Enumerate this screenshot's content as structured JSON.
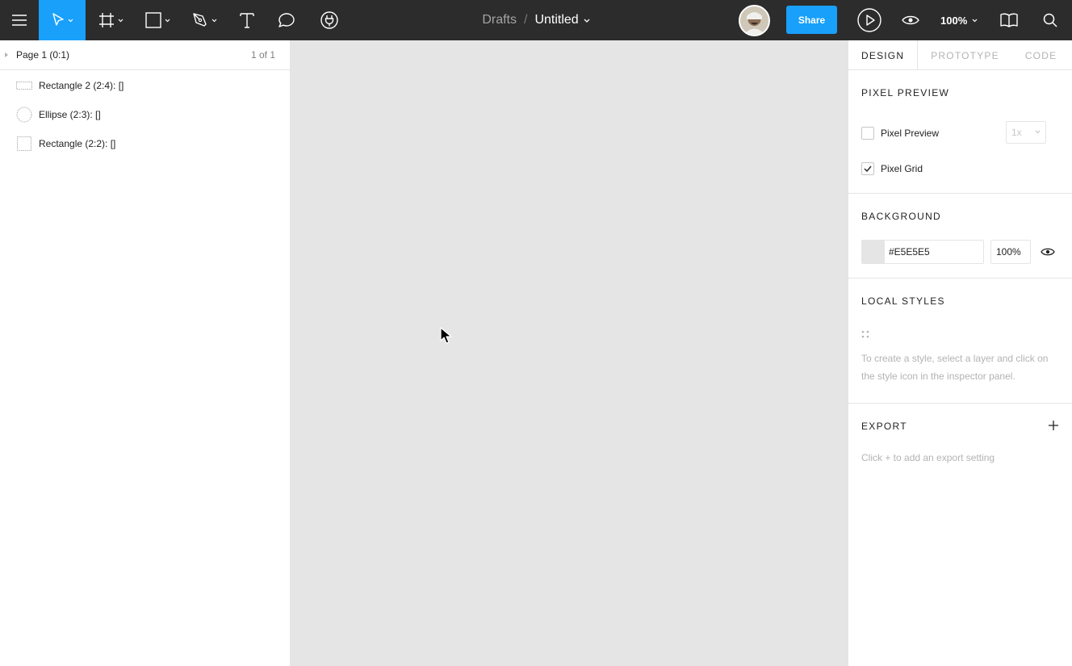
{
  "toolbar": {
    "zoom": "100%",
    "share_label": "Share",
    "icons": [
      "hamburger-menu-icon",
      "move-tool-icon",
      "frame-tool-icon",
      "rectangle-tool-icon",
      "pen-tool-icon",
      "text-tool-icon",
      "comment-tool-icon",
      "plugins-icon",
      "play-icon",
      "eye-icon",
      "library-icon",
      "search-icon"
    ],
    "accent": "#18A0FB"
  },
  "breadcrumb": {
    "project": "Drafts",
    "separator": "/",
    "file": "Untitled"
  },
  "layers": {
    "page": "Page 1 (0:1)",
    "page_count": "1 of 1",
    "items": [
      {
        "label": "Rectangle 2 (2:4): []",
        "icon": "rectangle-wide-icon"
      },
      {
        "label": "Ellipse (2:3): []",
        "icon": "ellipse-icon"
      },
      {
        "label": "Rectangle (2:2): []",
        "icon": "rectangle-icon"
      }
    ]
  },
  "props": {
    "tabs": [
      "DESIGN",
      "PROTOTYPE",
      "CODE"
    ],
    "pixel_preview": {
      "title": "PIXEL PREVIEW",
      "preview_label": "Pixel Preview",
      "preview_checked": false,
      "scale": "1x",
      "grid_label": "Pixel Grid",
      "grid_checked": true
    },
    "background": {
      "title": "BACKGROUND",
      "hex": "#E5E5E5",
      "opacity": "100%",
      "color": "#E5E5E5"
    },
    "local_styles": {
      "title": "LOCAL STYLES",
      "empty_text": "To create a style, select a layer and click on the style icon in the inspector panel."
    },
    "export": {
      "title": "EXPORT",
      "empty_text": "Click + to add an export setting"
    }
  }
}
